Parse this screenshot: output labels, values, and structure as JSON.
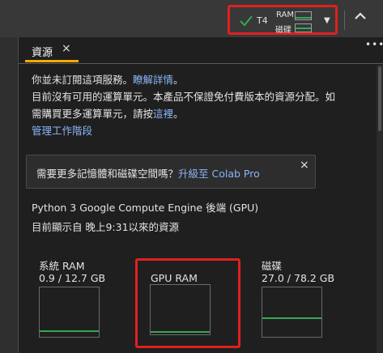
{
  "header": {
    "gpu": "T4",
    "ram_label": "RAM",
    "disk_label": "磁碟",
    "ram_usage_fraction": 0.07,
    "disk_usage_fraction": 0.35
  },
  "panel": {
    "tab_label": "資源",
    "tab_close": "×",
    "more": "•••"
  },
  "notice": {
    "line1": "你並未訂閱這項服務。",
    "learn_more": "瞭解詳情",
    "line1_end": "。",
    "line2a": "目前沒有可用的運算單元。本產品不保證免付費版本的資源分配。如",
    "line2b_pre": "需購買更多運算單元，請按",
    "here": "這裡",
    "line2b_end": "。",
    "manage": "管理工作階段"
  },
  "promo": {
    "text": "需要更多記憶體和磁碟空間嗎？",
    "link": "升級至 Colab Pro",
    "close": "×"
  },
  "engine": {
    "title": "Python 3 Google Compute Engine 後端 (GPU)",
    "since": "目前顯示自 晚上9:31以來的資源"
  },
  "gauges": [
    {
      "title": "系統 RAM",
      "value": "0.9 / 12.7 GB",
      "fraction": 0.07
    },
    {
      "title": "GPU RAM",
      "value": "",
      "fraction": 0.0
    },
    {
      "title": "磁碟",
      "value": "27.0 / 78.2 GB",
      "fraction": 0.35
    }
  ],
  "colors": {
    "accent": "#f9ab00",
    "link": "#8ab4f8",
    "usage": "#34a853",
    "highlight": "#e02020"
  }
}
